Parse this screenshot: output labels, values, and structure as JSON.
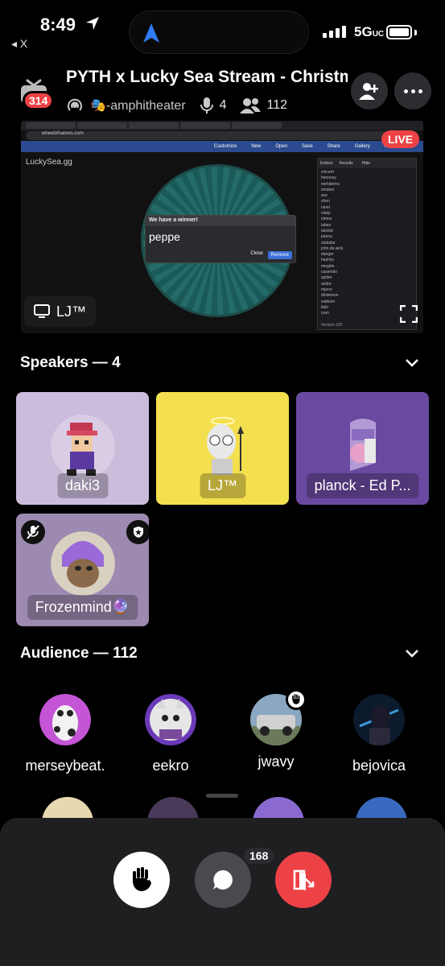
{
  "status": {
    "time": "8:49",
    "back_app": "◂ X",
    "network": "5G",
    "network_suffix": "UC"
  },
  "header": {
    "notification_count": "314",
    "title": "PYTH x Lucky Sea Stream - Christmas",
    "channel": "-amphitheater",
    "channel_emoji": "🎭",
    "listener_count": "4",
    "member_count": "112"
  },
  "stream": {
    "live_label": "LIVE",
    "presenter": "LJ™",
    "site_title": "LuckySea.gg",
    "url": "wheelofnames.com",
    "winner_title": "We have a winner!",
    "winner_name": "peppe",
    "close_label": "Close",
    "remove_label": "Remove",
    "entries_tab": "Entries",
    "results_tab": "Results",
    "hide_label": "Hide",
    "version": "Version 326",
    "menu": [
      "Customize",
      "New",
      "Open",
      "Save",
      "Share",
      "Gallery",
      "More"
    ],
    "entries": [
      "vincent",
      "hennesy",
      "mehdinmx",
      "smoker",
      "ace",
      "shen",
      "nmer",
      "vitaly",
      "nimos",
      "labeo",
      "akshat",
      "panna",
      "stakabe",
      "john.de.wick",
      "danger",
      "hashiry",
      "megido",
      "casenido",
      "spider",
      "andre",
      "mjeno",
      "dimlemon",
      "wattson",
      "italo",
      "ryan"
    ]
  },
  "speakers": {
    "heading": "Speakers — 4",
    "items": [
      {
        "name": "daki3",
        "bg": "#cbbcdc"
      },
      {
        "name": "LJ™",
        "bg": "#f4df4e"
      },
      {
        "name": "planck - Ed P...",
        "bg": "#6a4aa0"
      },
      {
        "name": "Frozenmind🔮",
        "bg": "#9c8ab0"
      }
    ]
  },
  "audience": {
    "heading": "Audience — 112",
    "items": [
      {
        "name": "merseybeat."
      },
      {
        "name": "eekro"
      },
      {
        "name": "jwavy"
      },
      {
        "name": "bejovica"
      }
    ]
  },
  "tray": {
    "chat_count": "168"
  },
  "colors": {
    "live": "#ed4245",
    "leave": "#ed4245",
    "tray": "#1f1f22"
  }
}
